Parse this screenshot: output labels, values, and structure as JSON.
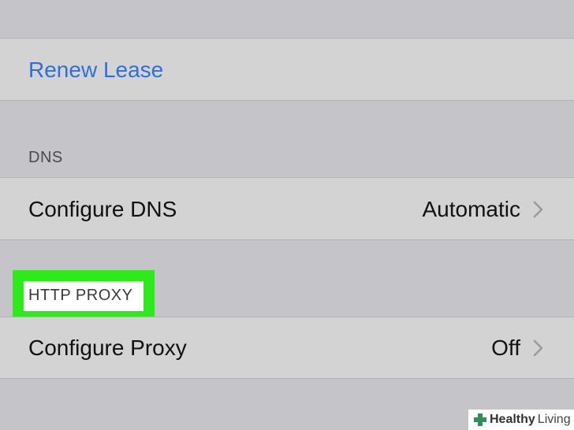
{
  "rows": {
    "renew_lease": {
      "label": "Renew Lease"
    },
    "configure_dns": {
      "label": "Configure DNS",
      "value": "Automatic"
    },
    "configure_proxy": {
      "label": "Configure Proxy",
      "value": "Off"
    }
  },
  "sections": {
    "dns_header": "DNS",
    "http_proxy_header": "HTTP PROXY"
  },
  "colors": {
    "link": "#2f6fd6",
    "highlight": "#2eea1c",
    "background": "#c5c5c9",
    "row_background": "#d3d3d3"
  },
  "watermark": {
    "icon": "plus-cross-icon",
    "bold_text": "Healthy",
    "light_text": "Living"
  }
}
